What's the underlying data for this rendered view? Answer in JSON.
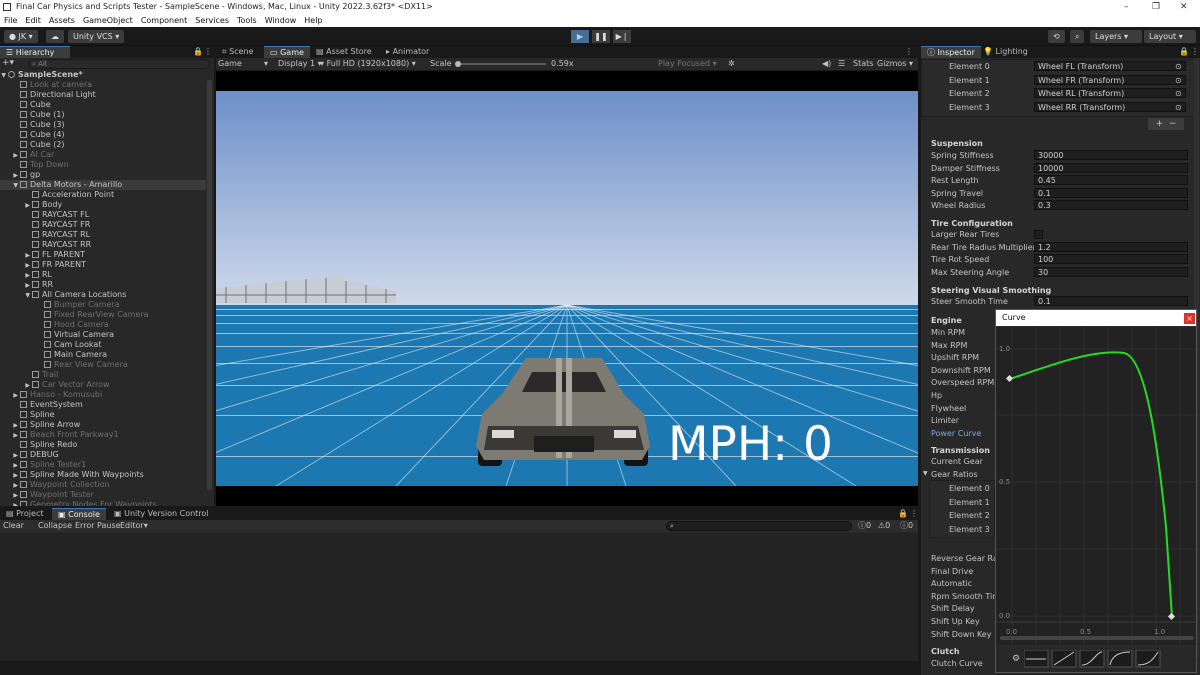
{
  "window": {
    "title": "Final Car Physics and Scripts Tester - SampleScene - Windows, Mac, Linux - Unity 2022.3.62f3* <DX11>",
    "controls": [
      "–",
      "❐",
      "✕"
    ]
  },
  "menu": [
    "File",
    "Edit",
    "Assets",
    "GameObject",
    "Component",
    "Services",
    "Tools",
    "Window",
    "Help"
  ],
  "toolbar": {
    "account": "JK ▾",
    "vcs": "Unity VCS ▾",
    "layers": "Layers",
    "layout": "Layout"
  },
  "hierarchy": {
    "tab": "Hierarchy",
    "search_placeholder": "All",
    "rows": [
      {
        "label": "SampleScene*",
        "indent": 0,
        "arrow": "▼",
        "icon": "scene",
        "dim": false
      },
      {
        "label": "Look at camera",
        "indent": 2,
        "arrow": "",
        "icon": "cube",
        "dim": true
      },
      {
        "label": "Directional Light",
        "indent": 2,
        "arrow": "",
        "icon": "cube",
        "dim": false
      },
      {
        "label": "Cube",
        "indent": 2,
        "arrow": "",
        "icon": "cube",
        "dim": false
      },
      {
        "label": "Cube (1)",
        "indent": 2,
        "arrow": "",
        "icon": "cube",
        "dim": false
      },
      {
        "label": "Cube (3)",
        "indent": 2,
        "arrow": "",
        "icon": "cube",
        "dim": false
      },
      {
        "label": "Cube (4)",
        "indent": 2,
        "arrow": "",
        "icon": "cube",
        "dim": false
      },
      {
        "label": "Cube (2)",
        "indent": 2,
        "arrow": "",
        "icon": "cube",
        "dim": false
      },
      {
        "label": "AI Car",
        "indent": 2,
        "arrow": "▶",
        "icon": "cube",
        "dim": true
      },
      {
        "label": "Top Down",
        "indent": 2,
        "arrow": "",
        "icon": "cube",
        "dim": true
      },
      {
        "label": "gp",
        "indent": 2,
        "arrow": "▶",
        "icon": "cube",
        "dim": false
      },
      {
        "label": "Delta Motors - Amarillo",
        "indent": 2,
        "arrow": "▼",
        "icon": "cube",
        "dim": false,
        "selected": true
      },
      {
        "label": "Acceleration Point",
        "indent": 4,
        "arrow": "",
        "icon": "cube",
        "dim": false
      },
      {
        "label": "Body",
        "indent": 4,
        "arrow": "▶",
        "icon": "cube",
        "dim": false
      },
      {
        "label": "RAYCAST FL",
        "indent": 4,
        "arrow": "",
        "icon": "cube",
        "dim": false
      },
      {
        "label": "RAYCAST FR",
        "indent": 4,
        "arrow": "",
        "icon": "cube",
        "dim": false
      },
      {
        "label": "RAYCAST RL",
        "indent": 4,
        "arrow": "",
        "icon": "cube",
        "dim": false
      },
      {
        "label": "RAYCAST RR",
        "indent": 4,
        "arrow": "",
        "icon": "cube",
        "dim": false
      },
      {
        "label": "FL PARENT",
        "indent": 4,
        "arrow": "▶",
        "icon": "cube",
        "dim": false
      },
      {
        "label": "FR PARENT",
        "indent": 4,
        "arrow": "▶",
        "icon": "cube",
        "dim": false
      },
      {
        "label": "RL",
        "indent": 4,
        "arrow": "▶",
        "icon": "cube",
        "dim": false
      },
      {
        "label": "RR",
        "indent": 4,
        "arrow": "▶",
        "icon": "cube",
        "dim": false
      },
      {
        "label": "All Camera Locations",
        "indent": 4,
        "arrow": "▼",
        "icon": "cube",
        "dim": false
      },
      {
        "label": "Bumper Camera",
        "indent": 6,
        "arrow": "",
        "icon": "cube",
        "dim": true
      },
      {
        "label": "Fixed RearView Camera",
        "indent": 6,
        "arrow": "",
        "icon": "cube",
        "dim": true
      },
      {
        "label": "Hood Camera",
        "indent": 6,
        "arrow": "",
        "icon": "cube",
        "dim": true
      },
      {
        "label": "Virtual Camera",
        "indent": 6,
        "arrow": "",
        "icon": "cube",
        "dim": false
      },
      {
        "label": "Cam Lookat",
        "indent": 6,
        "arrow": "",
        "icon": "cube",
        "dim": false
      },
      {
        "label": "Main Camera",
        "indent": 6,
        "arrow": "",
        "icon": "cube",
        "dim": false
      },
      {
        "label": "Rear View Camera",
        "indent": 6,
        "arrow": "",
        "icon": "cube",
        "dim": true
      },
      {
        "label": "Trail",
        "indent": 4,
        "arrow": "",
        "icon": "cube",
        "dim": true
      },
      {
        "label": "Car Vector Arrow",
        "indent": 4,
        "arrow": "▶",
        "icon": "cube",
        "dim": true
      },
      {
        "label": "Hanso - Komusubi",
        "indent": 2,
        "arrow": "▶",
        "icon": "cube",
        "dim": true
      },
      {
        "label": "EventSystem",
        "indent": 2,
        "arrow": "",
        "icon": "cube",
        "dim": false
      },
      {
        "label": "Spline",
        "indent": 2,
        "arrow": "",
        "icon": "cube",
        "dim": false
      },
      {
        "label": "Spline Arrow",
        "indent": 2,
        "arrow": "▶",
        "icon": "cube",
        "dim": false
      },
      {
        "label": "Beach Front Parkway1",
        "indent": 2,
        "arrow": "▶",
        "icon": "cube",
        "dim": true
      },
      {
        "label": "Spline Redo",
        "indent": 2,
        "arrow": "",
        "icon": "cube",
        "dim": false
      },
      {
        "label": "DEBUG",
        "indent": 2,
        "arrow": "▶",
        "icon": "cube",
        "dim": false
      },
      {
        "label": "Spline Tester1",
        "indent": 2,
        "arrow": "▶",
        "icon": "cube",
        "dim": true
      },
      {
        "label": "Spline Made With Waypoints",
        "indent": 2,
        "arrow": "▶",
        "icon": "cube",
        "dim": false
      },
      {
        "label": "Waypoint Collection",
        "indent": 2,
        "arrow": "▶",
        "icon": "cube",
        "dim": true
      },
      {
        "label": "Waypoint Tester",
        "indent": 2,
        "arrow": "▶",
        "icon": "cube",
        "dim": true
      },
      {
        "label": "Geometry Nodes For Waypoints",
        "indent": 2,
        "arrow": "▶",
        "icon": "cube",
        "dim": true
      }
    ]
  },
  "center_tabs": [
    "Scene",
    "Game",
    "Asset Store",
    "Animator"
  ],
  "game_toolbar": {
    "mode": "Game",
    "display": "Display 1",
    "resolution": "Full HD (1920x1080)",
    "scale_label": "Scale",
    "scale_value": "0.59x",
    "play_focused": "Play Focused",
    "stats": "Stats",
    "gizmos": "Gizmos"
  },
  "game": {
    "speed_label": "MPH: 0"
  },
  "bottom": {
    "tabs": [
      "Project",
      "Console",
      "Unity Version Control"
    ],
    "buttons": [
      "Clear",
      "Collapse",
      "Error Pause",
      "Editor"
    ],
    "counts": [
      "0",
      "0",
      "0"
    ]
  },
  "inspector": {
    "tabs": [
      "Inspector",
      "Lighting"
    ],
    "wheels": [
      {
        "label": "Element 0",
        "value": "Wheel FL (Transform)"
      },
      {
        "label": "Element 1",
        "value": "Wheel FR (Transform)"
      },
      {
        "label": "Element 2",
        "value": "Wheel RL (Transform)"
      },
      {
        "label": "Element 3",
        "value": "Wheel RR (Transform)"
      }
    ],
    "suspension": {
      "title": "Suspension",
      "rows": [
        {
          "label": "Spring Stiffness",
          "value": "30000"
        },
        {
          "label": "Damper Stiffness",
          "value": "10000"
        },
        {
          "label": "Rest Length",
          "value": "0.45"
        },
        {
          "label": "Spring Travel",
          "value": "0.1"
        },
        {
          "label": "Wheel Radius",
          "value": "0.3"
        }
      ]
    },
    "tire": {
      "title": "Tire Configuration",
      "rows": [
        {
          "label": "Larger Rear Tires",
          "value": ""
        },
        {
          "label": "Rear Tire Radius Multiplier",
          "value": "1.2"
        },
        {
          "label": "Tire Rot Speed",
          "value": "100"
        },
        {
          "label": "Max Steering Angle",
          "value": "30"
        }
      ]
    },
    "steering": {
      "title": "Steering Visual Smoothing",
      "rows": [
        {
          "label": "Steer Smooth Time",
          "value": "0.1"
        }
      ]
    },
    "engine": {
      "title": "Engine",
      "rows": [
        "Min RPM",
        "Max RPM",
        "Upshift RPM",
        "Downshift RPM",
        "Overspeed RPM",
        "Hp",
        "Flywheel",
        "Limiter",
        "Power Curve"
      ]
    },
    "transmission": {
      "title": "Transmission",
      "rows": [
        "Current Gear",
        "Gear Ratios"
      ],
      "gears": [
        "Element 0",
        "Element 1",
        "Element 2",
        "Element 3"
      ],
      "rows2": [
        "Reverse Gear Ratio",
        "Final Drive",
        "Automatic",
        "Rpm Smooth Time",
        "Shift Delay",
        "Shift Up Key",
        "Shift Down Key"
      ]
    },
    "clutch": {
      "title": "Clutch",
      "sub": "Clutch Curve"
    }
  },
  "curve_window": {
    "title": "Curve",
    "y_ticks": [
      "1.0",
      "0.5",
      "0.0"
    ],
    "x_ticks": [
      "0.0",
      "0.5",
      "1.0"
    ],
    "curve_color": "#22dd22"
  },
  "colors": {
    "accent": "#3a79bb",
    "sky_top": "#6d8fc9",
    "sky_bottom": "#cfd9ea",
    "ground": "#1d77b0",
    "close_red": "#d9342b"
  }
}
